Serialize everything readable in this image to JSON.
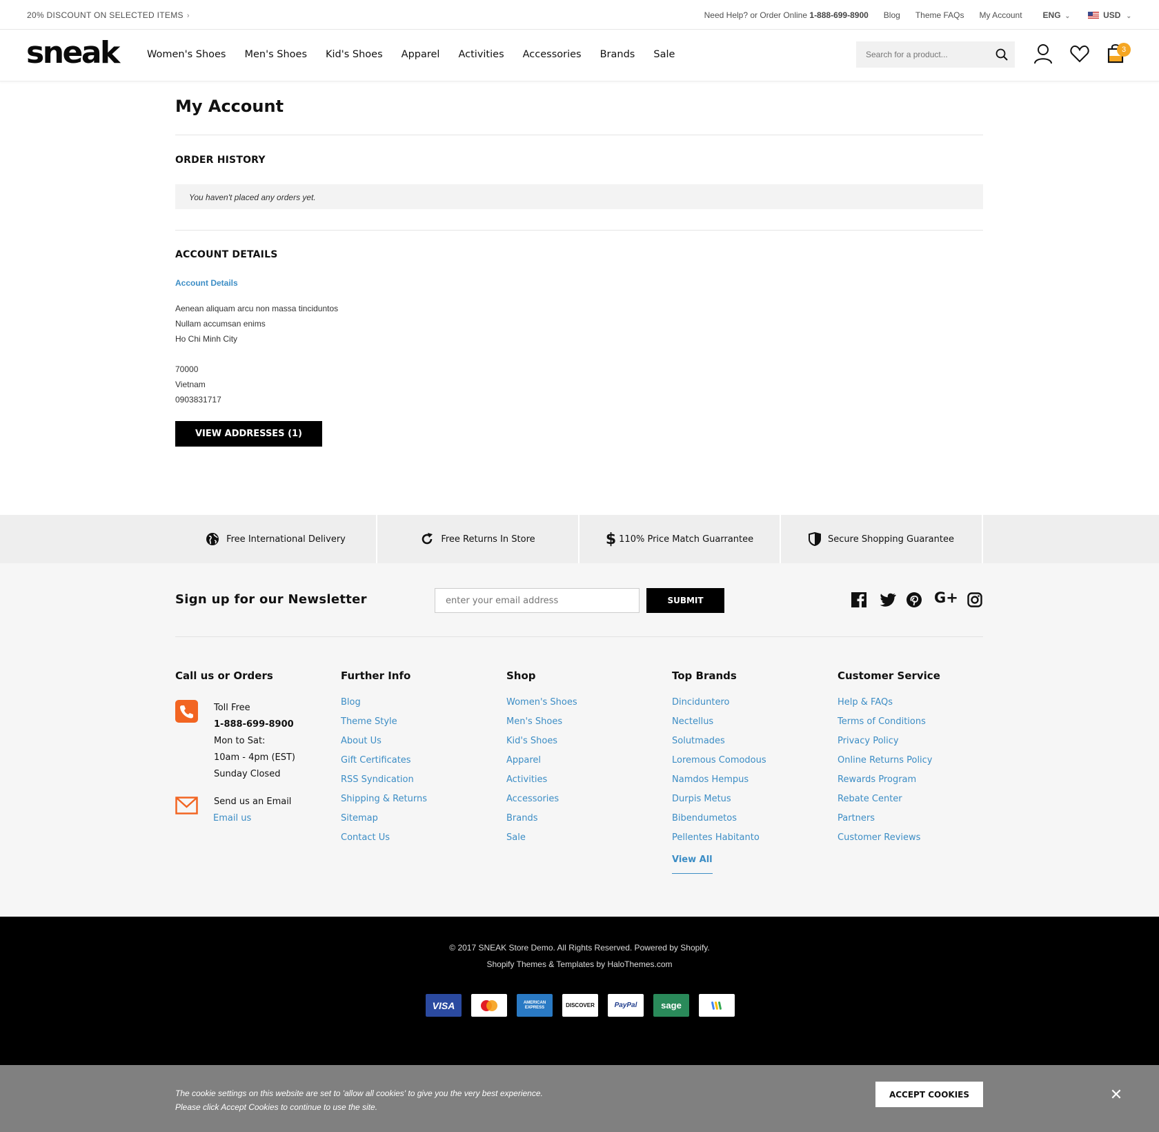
{
  "topbar": {
    "promo": "20% DISCOUNT ON SELECTED ITEMS",
    "help_text": "Need Help? or Order Online",
    "phone": "1-888-699-8900",
    "links": [
      "Blog",
      "Theme FAQs",
      "My Account"
    ],
    "language": "ENG",
    "currency": "USD"
  },
  "header": {
    "logo": "sneak",
    "nav": [
      "Women's Shoes",
      "Men's Shoes",
      "Kid's Shoes",
      "Apparel",
      "Activities",
      "Accessories",
      "Brands",
      "Sale"
    ],
    "search_placeholder": "Search for a product...",
    "cart_count": "3"
  },
  "main": {
    "title": "My Account",
    "order_history": {
      "title": "ORDER HISTORY",
      "empty_notice": "You haven't placed any orders yet."
    },
    "account_details": {
      "title": "ACCOUNT DETAILS",
      "link": "Account Details",
      "address_lines": [
        "Aenean aliquam arcu non massa tinciduntos",
        "Nullam accumsan enims",
        "Ho Chi Minh City",
        "",
        "70000",
        "Vietnam",
        "0903831717"
      ],
      "button": "VIEW ADDRESSES (1)"
    }
  },
  "features": [
    {
      "icon": "globe-icon",
      "label": "Free International Delivery"
    },
    {
      "icon": "refresh-icon",
      "label": "Free Returns In Store"
    },
    {
      "icon": "dollar-icon",
      "label": "110% Price Match Guarrantee"
    },
    {
      "icon": "shield-icon",
      "label": "Secure Shopping Guarantee"
    }
  ],
  "newsletter": {
    "title": "Sign up for our Newsletter",
    "placeholder": "enter your email address",
    "button": "SUBMIT",
    "social": [
      "facebook-icon",
      "twitter-icon",
      "pinterest-icon",
      "google-plus-icon",
      "instagram-icon"
    ]
  },
  "footer": {
    "contact": {
      "title": "Call us or Orders",
      "phone_lines": [
        "Toll Free",
        "1-888-699-8900",
        "Mon to Sat:",
        "10am - 4pm (EST)",
        "Sunday Closed"
      ],
      "email_label": "Send us an Email",
      "email_link": "Email us"
    },
    "further_info": {
      "title": "Further Info",
      "links": [
        "Blog",
        "Theme Style",
        "About Us",
        "Gift Certificates",
        "RSS Syndication",
        "Shipping & Returns",
        "Sitemap",
        "Contact Us"
      ]
    },
    "shop": {
      "title": "Shop",
      "links": [
        "Women's Shoes",
        "Men's Shoes",
        "Kid's Shoes",
        "Apparel",
        "Activities",
        "Accessories",
        "Brands",
        "Sale"
      ]
    },
    "top_brands": {
      "title": "Top Brands",
      "links": [
        "Dinciduntero",
        "Nectellus",
        "Solutmades",
        "Loremous Comodous",
        "Namdos Hempus",
        "Durpis Metus",
        "Bibendumetos",
        "Pellentes Habitanto"
      ],
      "view_all": "View All"
    },
    "customer_service": {
      "title": "Customer Service",
      "links": [
        "Help & FAQs",
        "Terms of Conditions",
        "Privacy Policy",
        "Online Returns Policy",
        "Rewards Program",
        "Rebate Center",
        "Partners",
        "Customer Reviews"
      ]
    }
  },
  "bottom": {
    "copyright": "© 2017 SNEAK Store Demo. All Rights Reserved. Powered by Shopify.",
    "credit": "Shopify Themes & Templates by HaloThemes.com",
    "payments": [
      "VISA",
      "MasterCard",
      "AMERICAN EXPRESS",
      "DISCOVER",
      "PayPal",
      "sage",
      "Google Wallet"
    ]
  },
  "cookie": {
    "line1": "The cookie settings on this website are set to 'allow all cookies' to give you the very best experience.",
    "line2": "Please click Accept Cookies to continue to use the site.",
    "button": "ACCEPT COOKIES"
  },
  "colors": {
    "accent_link": "#3c8dc5",
    "badge": "#f5a623",
    "orange_icon": "#f26522"
  }
}
